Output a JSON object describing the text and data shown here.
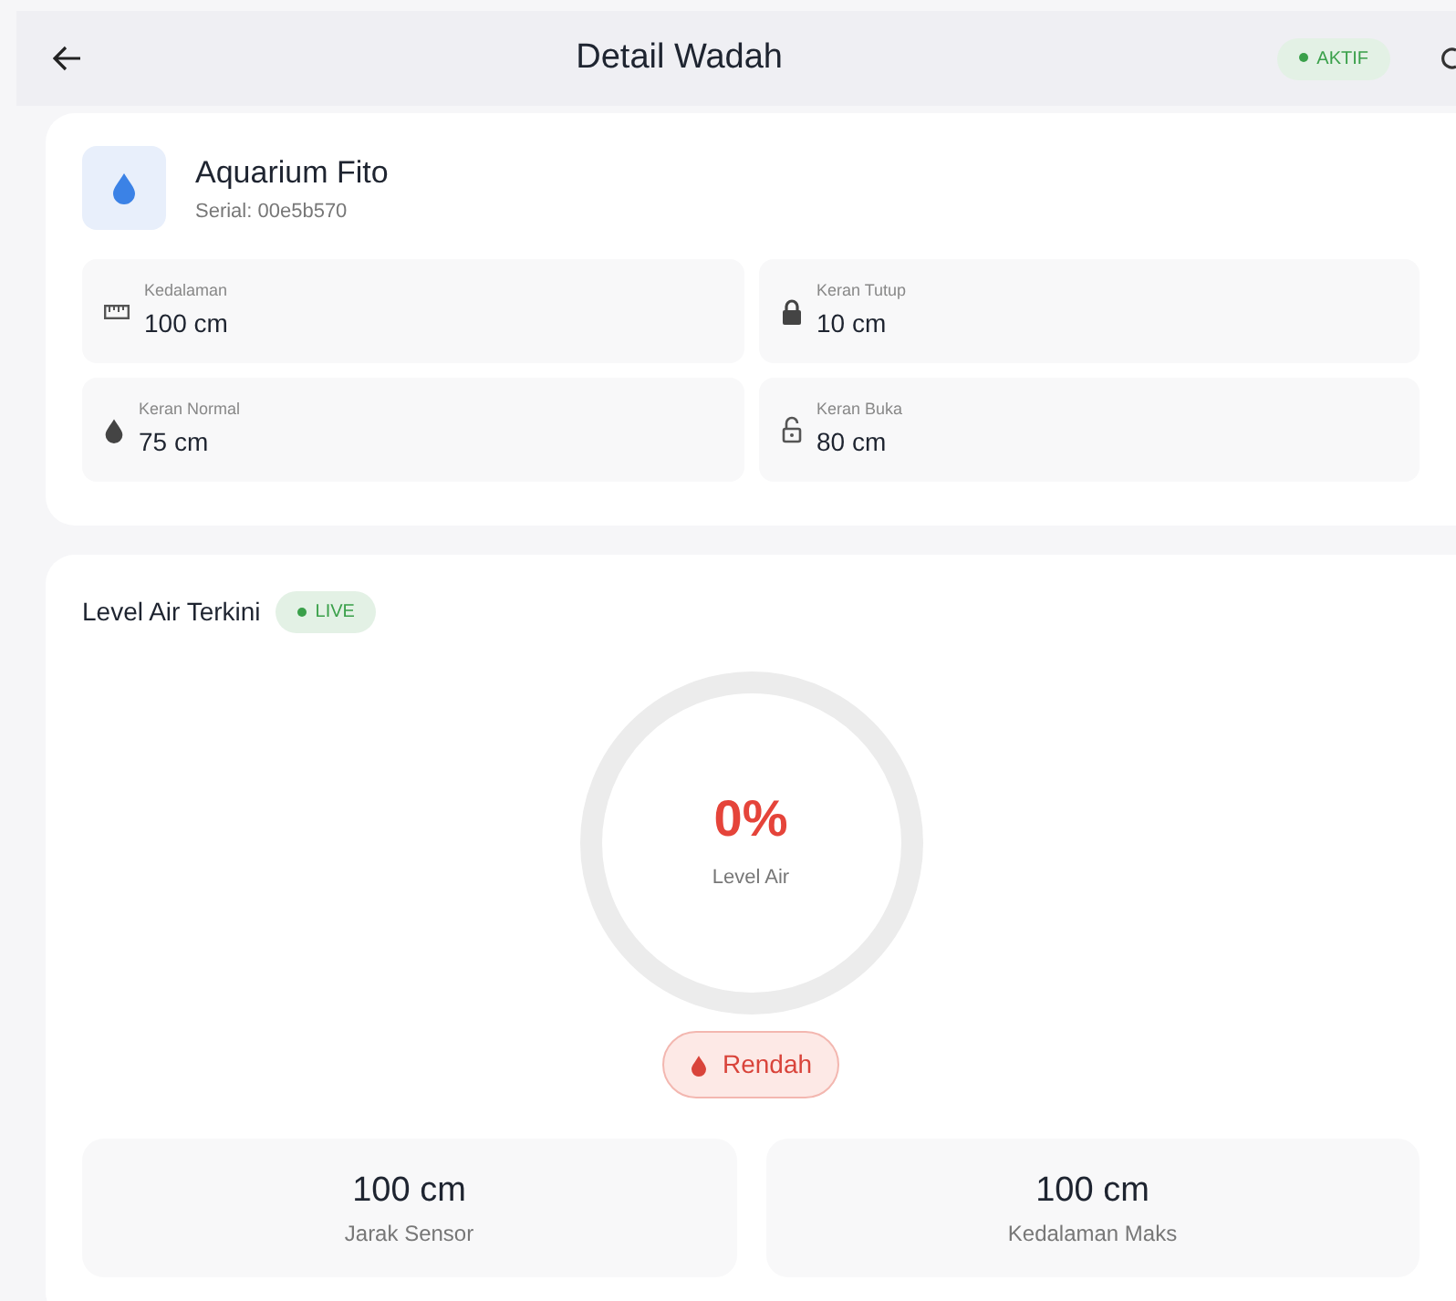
{
  "header": {
    "title": "Detail Wadah",
    "status_badge": "AKTIF"
  },
  "container": {
    "name": "Aquarium Fito",
    "serial": "Serial: 00e5b570",
    "specs": [
      {
        "label": "Kedalaman",
        "value": "100 cm"
      },
      {
        "label": "Keran Tutup",
        "value": "10 cm"
      },
      {
        "label": "Keran Normal",
        "value": "75 cm"
      },
      {
        "label": "Keran Buka",
        "value": "80 cm"
      }
    ]
  },
  "water_level": {
    "title": "Level Air Terkini",
    "live_badge": "LIVE",
    "percent": "0%",
    "caption": "Level Air",
    "status": "Rendah",
    "stats": [
      {
        "value": "100 cm",
        "label": "Jarak Sensor"
      },
      {
        "value": "100 cm",
        "label": "Kedalaman Maks"
      }
    ]
  }
}
